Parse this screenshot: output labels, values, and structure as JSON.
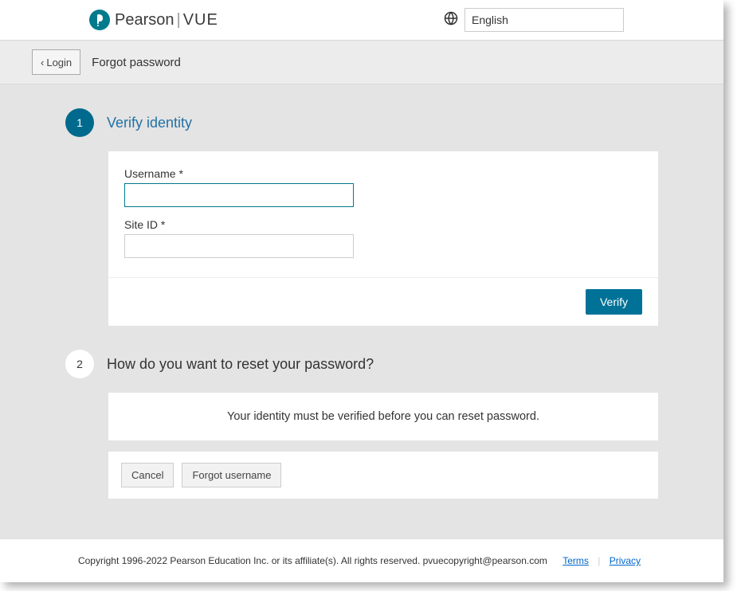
{
  "header": {
    "logo": {
      "brand": "Pearson",
      "separator": "|",
      "product": "VUE"
    },
    "language": "English"
  },
  "breadcrumb": {
    "login_label": "Login",
    "page_title": "Forgot password"
  },
  "steps": {
    "step1": {
      "number": "1",
      "title": "Verify identity",
      "username_label": "Username *",
      "siteid_label": "Site ID *",
      "verify_button": "Verify"
    },
    "step2": {
      "number": "2",
      "title": "How do you want to reset your password?",
      "info_text": "Your identity must be verified before you can reset password."
    }
  },
  "actions": {
    "cancel": "Cancel",
    "forgot_username": "Forgot username"
  },
  "footer": {
    "copyright": "Copyright 1996-2022 Pearson Education Inc. or its affiliate(s). All rights reserved. pvuecopyright@pearson.com",
    "terms": "Terms",
    "privacy": "Privacy"
  }
}
